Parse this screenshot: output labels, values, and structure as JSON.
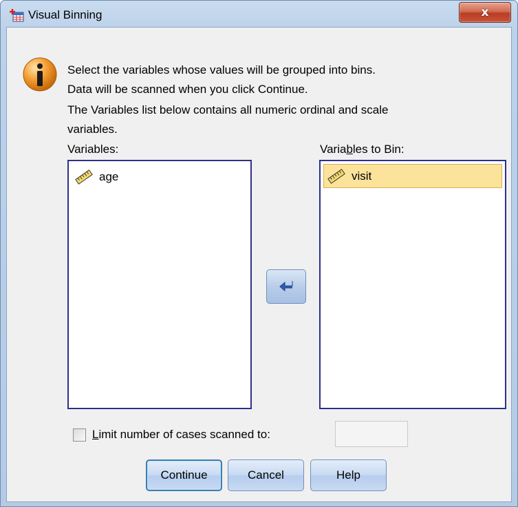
{
  "window": {
    "title": "Visual Binning",
    "close_label": "x"
  },
  "info": {
    "line1": "Select the variables whose values will be grouped into bins.",
    "line2": "Data will be scanned when you click Continue.",
    "line3": "The Variables list below contains all numeric ordinal and scale",
    "line4": "variables."
  },
  "variables": {
    "label": "Variables:",
    "items": [
      {
        "label": "age",
        "icon": "ruler-icon",
        "selected": false
      }
    ]
  },
  "bin": {
    "label_prefix": "Varia",
    "label_mnemonic": "b",
    "label_suffix": "les to Bin:",
    "items": [
      {
        "label": "visit",
        "icon": "ruler-icon",
        "selected": true
      }
    ]
  },
  "limit": {
    "label_mnemonic": "L",
    "label_rest": "imit number of cases scanned to:",
    "checked": false,
    "value": ""
  },
  "buttons": {
    "continue": "Continue",
    "cancel": "Cancel",
    "help": "Help"
  },
  "colors": {
    "selection": "#fbe39b",
    "list_border": "#2c2f8a",
    "button_blue": "#c9dbf2"
  }
}
